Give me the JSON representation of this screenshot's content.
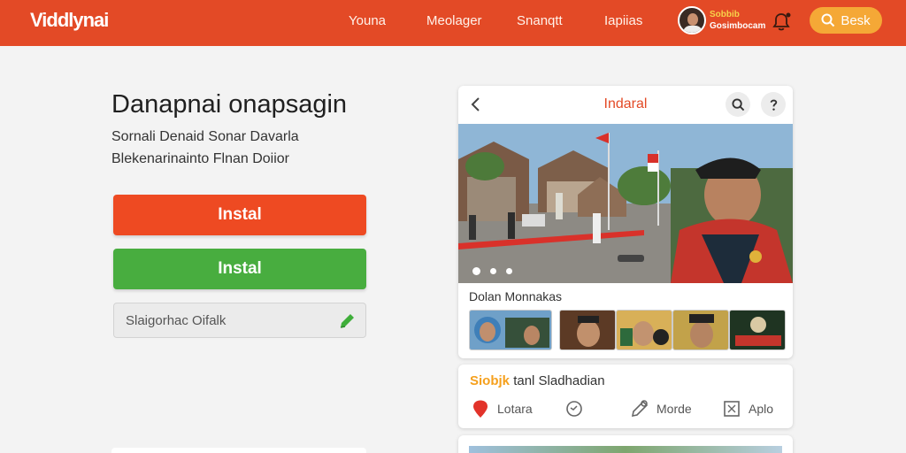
{
  "header": {
    "logo_main": "Viddlynai",
    "nav": [
      "Youna",
      "Meolager",
      "Snanqtt",
      "Iapiias"
    ],
    "user_name": "Sobbib",
    "user_sub": "Gosimbocam",
    "search_label": "Besk"
  },
  "hero": {
    "title": "Danapnai onapsagin",
    "line1": "Sornali Denaid Sonar Davarla",
    "line2": "Blekenarinainto Flnan Doiior"
  },
  "buttons": {
    "primary": "Instal",
    "secondary": "Instal"
  },
  "input": {
    "value": "Slaigorhac Oifalk"
  },
  "card": {
    "title": "Indaral",
    "strip_label": "Dolan Monnakas",
    "thumbnail_count": 5
  },
  "action_card": {
    "title_highlight": "Siobjk",
    "title_rest": "tanl Sladhadian",
    "actions": [
      "Lotara",
      "",
      "Morde",
      "Aplo"
    ]
  },
  "colors": {
    "header": "#e34a26",
    "accent_orange": "#ee4a22",
    "accent_green": "#48ad3f",
    "search_button": "#f5a836"
  }
}
